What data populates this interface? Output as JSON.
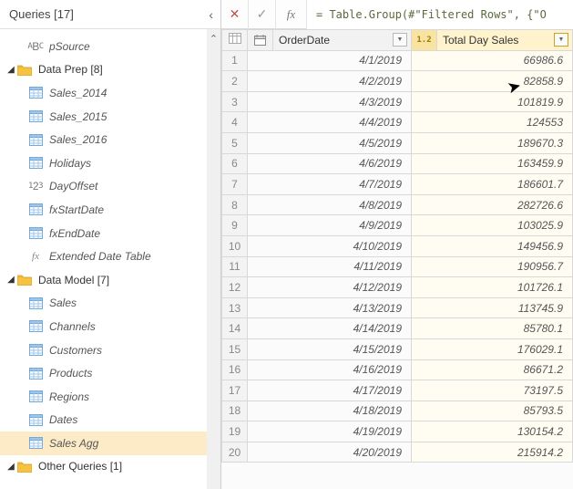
{
  "sidebar": {
    "title": "Queries [17]",
    "groups": [
      {
        "name": "pSource",
        "kind": "param-text",
        "depth": 2
      }
    ],
    "dataPrep": {
      "label": "Data Prep [8]",
      "items": [
        {
          "label": "Sales_2014",
          "kind": "table"
        },
        {
          "label": "Sales_2015",
          "kind": "table"
        },
        {
          "label": "Sales_2016",
          "kind": "table"
        },
        {
          "label": "Holidays",
          "kind": "table"
        },
        {
          "label": "DayOffset",
          "kind": "number"
        },
        {
          "label": "fxStartDate",
          "kind": "table"
        },
        {
          "label": "fxEndDate",
          "kind": "table"
        },
        {
          "label": "Extended Date Table",
          "kind": "fx"
        }
      ]
    },
    "dataModel": {
      "label": "Data Model [7]",
      "items": [
        {
          "label": "Sales",
          "kind": "table"
        },
        {
          "label": "Channels",
          "kind": "table"
        },
        {
          "label": "Customers",
          "kind": "table"
        },
        {
          "label": "Products",
          "kind": "table"
        },
        {
          "label": "Regions",
          "kind": "table"
        },
        {
          "label": "Dates",
          "kind": "table"
        },
        {
          "label": "Sales Agg",
          "kind": "table",
          "selected": true
        }
      ]
    },
    "otherQueries": {
      "label": "Other Queries [1]"
    }
  },
  "formula": "= Table.Group(#\"Filtered Rows\", {\"O",
  "columns": {
    "c0type": "📅",
    "c0name": "OrderDate",
    "c1type": "1.2",
    "c1name": "Total Day Sales"
  },
  "chart_data": {
    "type": "table",
    "columns": [
      "OrderDate",
      "Total Day Sales"
    ],
    "rows": [
      [
        "4/1/2019",
        66986.6
      ],
      [
        "4/2/2019",
        82858.9
      ],
      [
        "4/3/2019",
        101819.9
      ],
      [
        "4/4/2019",
        124553
      ],
      [
        "4/5/2019",
        189670.3
      ],
      [
        "4/6/2019",
        163459.9
      ],
      [
        "4/7/2019",
        186601.7
      ],
      [
        "4/8/2019",
        282726.6
      ],
      [
        "4/9/2019",
        103025.9
      ],
      [
        "4/10/2019",
        149456.9
      ],
      [
        "4/11/2019",
        190956.7
      ],
      [
        "4/12/2019",
        101726.1
      ],
      [
        "4/13/2019",
        113745.9
      ],
      [
        "4/14/2019",
        85780.1
      ],
      [
        "4/15/2019",
        176029.1
      ],
      [
        "4/16/2019",
        86671.2
      ],
      [
        "4/17/2019",
        73197.5
      ],
      [
        "4/18/2019",
        85793.5
      ],
      [
        "4/19/2019",
        130154.2
      ],
      [
        "4/20/2019",
        215914.2
      ]
    ]
  }
}
